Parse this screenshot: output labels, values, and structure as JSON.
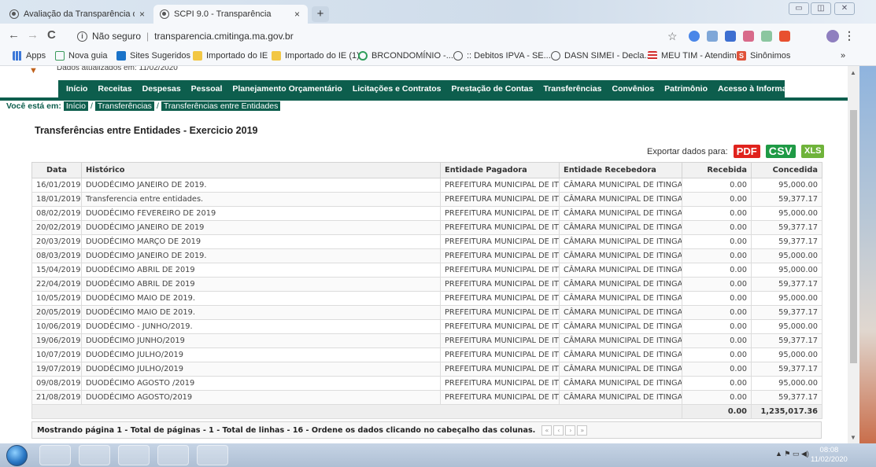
{
  "browser": {
    "tabs": [
      {
        "title": "Avaliação da Transparência dos /",
        "close": "×"
      },
      {
        "title": "SCPI 9.0 - Transparência",
        "close": "×"
      }
    ],
    "new_tab": "+",
    "nav": {
      "back": "←",
      "forward": "→",
      "reload": "C"
    },
    "security_label": "Não seguro",
    "url": "transparencia.cmitinga.ma.gov.br",
    "bookmarks": [
      "Apps",
      "Nova guia",
      "Sites Sugeridos",
      "Importado do IE",
      "Importado do IE (1)",
      "BRCONDOMÍNIO -...",
      ":: Debitos IPVA - SE...",
      "DASN SIMEI - Decla...",
      "MEU TIM - Atendim...",
      "Sinônimos"
    ],
    "bookmarks_more": "»"
  },
  "site": {
    "updated_text": "Dados atualizados em: 11/02/2020",
    "menu": [
      "Início",
      "Receitas",
      "Despesas",
      "Pessoal",
      "Planejamento Orçamentário",
      "Licitações e Contratos",
      "Prestação de Contas",
      "Transferências",
      "Convênios",
      "Patrimônio",
      "Acesso à Informação"
    ],
    "breadcrumb": {
      "label": "Você está em:",
      "items": [
        "Início",
        "Transferências",
        "Transferências entre Entidades"
      ],
      "sep": "/"
    },
    "page_title": "Transferências entre Entidades - Exercicio 2019",
    "export": {
      "label": "Exportar dados para:",
      "pdf": "PDF",
      "csv": "CSV",
      "xls": "XLS"
    }
  },
  "table": {
    "headers": [
      "Data",
      "Histórico",
      "Entidade Pagadora",
      "Entidade Recebedora",
      "Recebida",
      "Concedida"
    ],
    "rows": [
      [
        "16/01/2019",
        "DUODÉCIMO JANEIRO DE 2019.",
        "PREFEITURA MUNICIPAL DE ITINGA",
        "CÂMARA MUNICIPAL DE ITINGA D",
        "0.00",
        "95,000.00"
      ],
      [
        "18/01/2019",
        "Transferencia entre entidades.",
        "PREFEITURA MUNICIPAL DE ITINGA",
        "CÂMARA MUNICIPAL DE ITINGA D",
        "0.00",
        "59,377.17"
      ],
      [
        "08/02/2019",
        "DUODÉCIMO FEVEREIRO DE 2019",
        "PREFEITURA MUNICIPAL DE ITINGA",
        "CÂMARA MUNICIPAL DE ITINGA D",
        "0.00",
        "95,000.00"
      ],
      [
        "20/02/2019",
        "DUODÉCIMO JANEIRO DE 2019",
        "PREFEITURA MUNICIPAL DE ITINGA",
        "CÂMARA MUNICIPAL DE ITINGA D",
        "0.00",
        "59,377.17"
      ],
      [
        "20/03/2019",
        "DUODÉCIMO MARÇO DE 2019",
        "PREFEITURA MUNICIPAL DE ITINGA",
        "CÂMARA MUNICIPAL DE ITINGA D",
        "0.00",
        "59,377.17"
      ],
      [
        "08/03/2019",
        "DUODÉCIMO JANEIRO DE 2019.",
        "PREFEITURA MUNICIPAL DE ITINGA",
        "CÂMARA MUNICIPAL DE ITINGA D",
        "0.00",
        "95,000.00"
      ],
      [
        "15/04/2019",
        "DUODÉCIMO ABRIL DE 2019",
        "PREFEITURA MUNICIPAL DE ITINGA",
        "CÂMARA MUNICIPAL DE ITINGA D",
        "0.00",
        "95,000.00"
      ],
      [
        "22/04/2019",
        "DUODÉCIMO ABRIL DE 2019",
        "PREFEITURA MUNICIPAL DE ITINGA",
        "CÂMARA MUNICIPAL DE ITINGA D",
        "0.00",
        "59,377.17"
      ],
      [
        "10/05/2019",
        "DUODÉCIMO MAIO DE 2019.",
        "PREFEITURA MUNICIPAL DE ITINGA",
        "CÂMARA MUNICIPAL DE ITINGA D",
        "0.00",
        "95,000.00"
      ],
      [
        "20/05/2019",
        "DUODÉCIMO MAIO DE 2019.",
        "PREFEITURA MUNICIPAL DE ITINGA",
        "CÂMARA MUNICIPAL DE ITINGA D",
        "0.00",
        "59,377.17"
      ],
      [
        "10/06/2019",
        "DUODÉCIMO - JUNHO/2019.",
        "PREFEITURA MUNICIPAL DE ITINGA",
        "CÂMARA MUNICIPAL DE ITINGA D",
        "0.00",
        "95,000.00"
      ],
      [
        "19/06/2019",
        "DUODÉCIMO JUNHO/2019",
        "PREFEITURA MUNICIPAL DE ITINGA",
        "CÂMARA MUNICIPAL DE ITINGA D",
        "0.00",
        "59,377.17"
      ],
      [
        "10/07/2019",
        "DUODÉCIMO JULHO/2019",
        "PREFEITURA MUNICIPAL DE ITINGA",
        "CÂMARA MUNICIPAL DE ITINGA D",
        "0.00",
        "95,000.00"
      ],
      [
        "19/07/2019",
        "DUODÉCIMO JULHO/2019",
        "PREFEITURA MUNICIPAL DE ITINGA",
        "CÂMARA MUNICIPAL DE ITINGA D",
        "0.00",
        "59,377.17"
      ],
      [
        "09/08/2019",
        "DUODÉCIMO AGOSTO /2019",
        "PREFEITURA MUNICIPAL DE ITINGA",
        "CÂMARA MUNICIPAL DE ITINGA D",
        "0.00",
        "95,000.00"
      ],
      [
        "21/08/2019",
        "DUODÉCIMO AGOSTO/2019",
        "PREFEITURA MUNICIPAL DE ITINGA",
        "CÂMARA MUNICIPAL DE ITINGA D",
        "0.00",
        "59,377.17"
      ]
    ],
    "totals": {
      "recebida": "0.00",
      "concedida": "1,235,017.36"
    }
  },
  "pager": {
    "text": "Mostrando página 1 - Total de páginas - 1 - Total de linhas - 16 - Ordene os dados clicando no cabeçalho das colunas.",
    "buttons": [
      "«",
      "‹",
      "›",
      "»"
    ]
  },
  "taskbar": {
    "time": "08:08",
    "date": "11/02/2020"
  },
  "colors": {
    "primary": "#0d5e4d",
    "pdf": "#e0231d",
    "csv": "#1f9a45",
    "xls": "#6fb33a"
  }
}
